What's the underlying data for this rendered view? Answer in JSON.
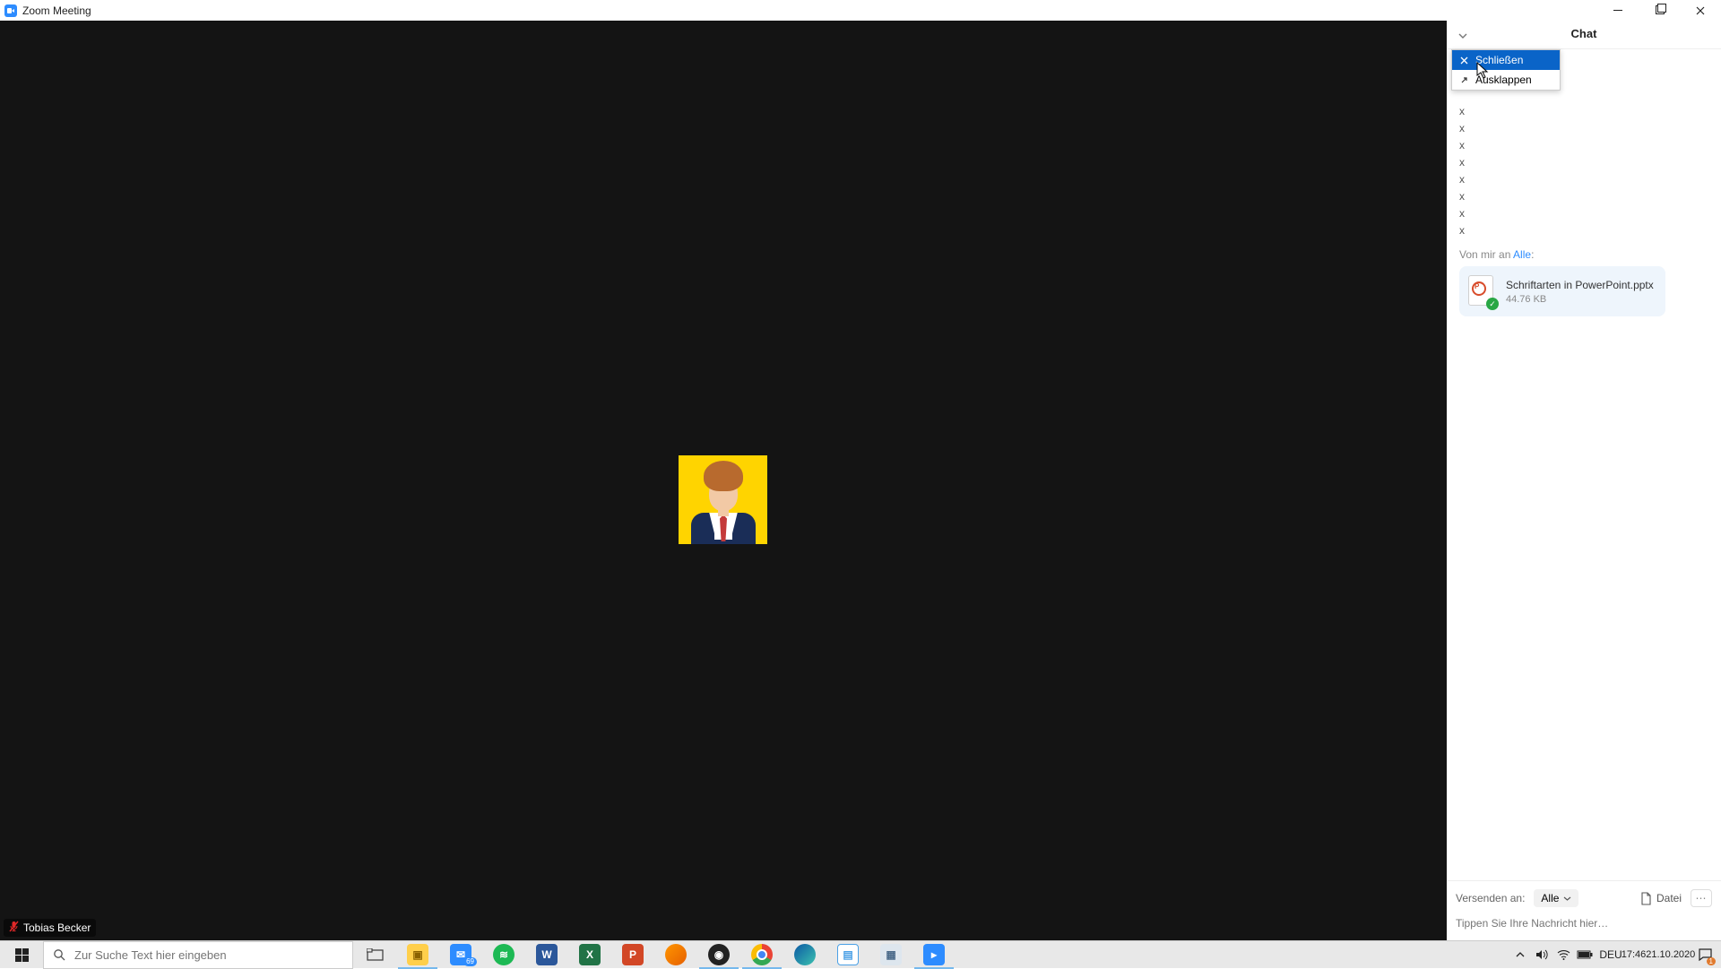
{
  "window": {
    "title": "Zoom Meeting"
  },
  "participant": {
    "name": "Tobias Becker"
  },
  "chat": {
    "title": "Chat",
    "dropdown": {
      "close": "Schließen",
      "popout": "Ausklappen"
    },
    "messages_x": [
      "x",
      "x",
      "x",
      "x",
      "x",
      "x",
      "x",
      "x"
    ],
    "from_prefix": "Von mir an ",
    "from_target": "Alle",
    "from_suffix": ":",
    "file": {
      "name": "Schriftarten in PowerPoint.pptx",
      "size": "44.76 KB"
    },
    "send_to_label": "Versenden an:",
    "send_to_value": "Alle",
    "file_button": "Datei",
    "more_button": "⋯",
    "input_placeholder": "Tippen Sie Ihre Nachricht hier…"
  },
  "taskbar": {
    "search_placeholder": "Zur Suche Text hier eingeben",
    "mail_badge": "69",
    "lang": "DEU",
    "time": "17:46",
    "date": "21.10.2020",
    "notif_badge": "1"
  }
}
